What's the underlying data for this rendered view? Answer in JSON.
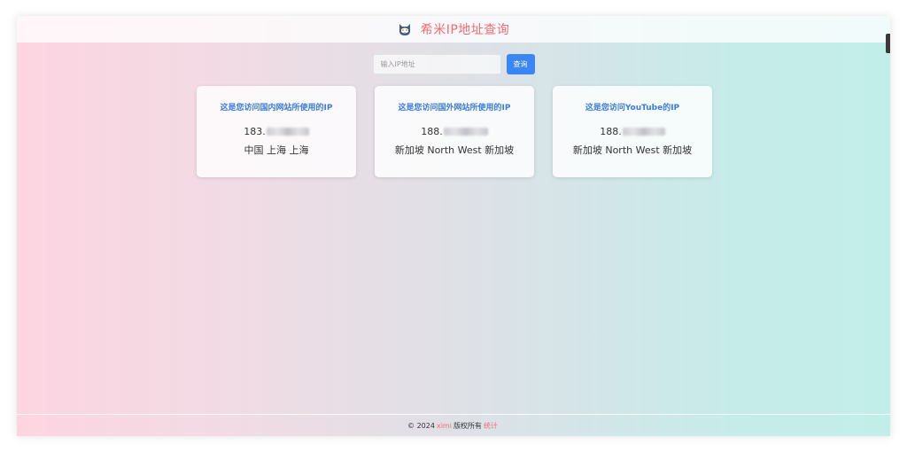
{
  "header": {
    "logo_icon": "cat-logo-icon",
    "title": "希米IP地址查询"
  },
  "search": {
    "placeholder": "输入IP地址",
    "button_label": "查询"
  },
  "cards": [
    {
      "title": "这是您访问国内网站所使用的IP",
      "ip_prefix": "183.",
      "location": "中国 上海 上海"
    },
    {
      "title": "这是您访问国外网站所使用的IP",
      "ip_prefix": "188.",
      "location": "新加坡 North West 新加坡"
    },
    {
      "title": "这是您访问YouTube的IP",
      "ip_prefix": "188.",
      "location": "新加坡 North West 新加坡"
    }
  ],
  "footer": {
    "copyright": "© 2024",
    "owner": "ximi",
    "rights": "版权所有",
    "stats_link": "统计"
  },
  "colors": {
    "accent": "#3a86f5",
    "title_red": "#f26b74",
    "card_title_blue": "#3b7de0"
  }
}
